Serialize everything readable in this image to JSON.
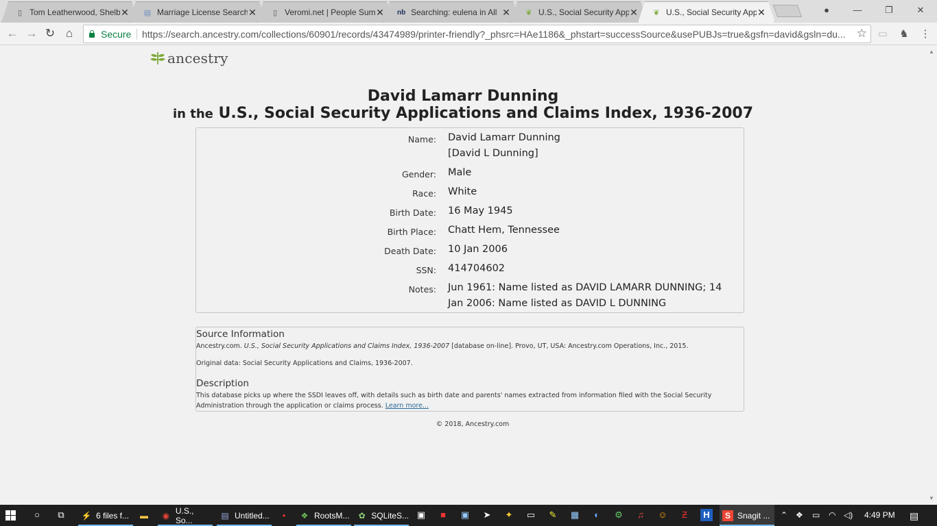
{
  "browser": {
    "tabs": [
      {
        "title": "Tom Leatherwood, Shelby",
        "icon": "document-icon"
      },
      {
        "title": "Marriage License Search",
        "icon": "page-icon"
      },
      {
        "title": "Veromi.net | People Sum",
        "icon": "document-icon"
      },
      {
        "title": "Searching: eulena in All",
        "icon": "nb-icon"
      },
      {
        "title": "U.S., Social Security App",
        "icon": "ancestry-leaf-icon"
      },
      {
        "title": "U.S., Social Security App",
        "icon": "ancestry-leaf-icon",
        "active": true
      }
    ],
    "secure_label": "Secure",
    "url": "https://search.ancestry.com/collections/60901/records/43474989/printer-friendly?_phsrc=HAe1186&_phstart=successSource&usePUBJs=true&gsfn=david&gsln=du..."
  },
  "page": {
    "logo_text": "ancestry",
    "person_name": "David Lamarr Dunning",
    "title_prefix": "in the",
    "collection_title": "U.S., Social Security Applications and Claims Index, 1936-2007",
    "fields": {
      "name": {
        "label": "Name:",
        "value": "David Lamarr Dunning",
        "value2": "[David L Dunning]"
      },
      "gender": {
        "label": "Gender:",
        "value": "Male"
      },
      "race": {
        "label": "Race:",
        "value": "White"
      },
      "birth_date": {
        "label": "Birth Date:",
        "value": "16 May 1945"
      },
      "birth_place": {
        "label": "Birth Place:",
        "value": "Chatt Hem, Tennessee"
      },
      "death_date": {
        "label": "Death Date:",
        "value": "10 Jan 2006"
      },
      "ssn": {
        "label": "SSN:",
        "value": "414704602"
      },
      "notes": {
        "label": "Notes:",
        "value": "Jun 1961: Name listed as DAVID LAMARR DUNNING; 14 Jan 2006: Name listed as DAVID L DUNNING"
      }
    },
    "source": {
      "heading": "Source Information",
      "citation_pre": "Ancestry.com.",
      "citation_title": "U.S., Social Security Applications and Claims Index, 1936-2007",
      "citation_post": "[database on-line]. Provo, UT, USA: Ancestry.com Operations, Inc., 2015.",
      "original_data": "Original data: Social Security Applications and Claims, 1936-2007."
    },
    "description": {
      "heading": "Description",
      "text": "This database picks up where the SSDI leaves off, with details such as birth date and parents' names extracted from information filed with the Social Security Administration through the application or claims process.",
      "link": "Learn more..."
    },
    "copyright": "© 2018, Ancestry.com"
  },
  "taskbar": {
    "apps": [
      {
        "label": "6 files f...",
        "icon": "git-icon"
      },
      {
        "label": "",
        "icon": "folder-icon"
      },
      {
        "label": "U.S., So...",
        "icon": "chrome-icon"
      },
      {
        "label": "Untitled...",
        "icon": "notepad-icon"
      },
      {
        "label": "",
        "icon": "red-dot-icon"
      },
      {
        "label": "RootsM...",
        "icon": "rootsmagic-icon"
      },
      {
        "label": "SQLiteS...",
        "icon": "sqlite-icon"
      },
      {
        "label": "Snagit ...",
        "icon": "snagit-icon"
      }
    ],
    "time": "4:49 PM"
  },
  "colors": {
    "ancestry_green": "#7ea93a",
    "secure_green": "#0b8043",
    "link_blue": "#2c6a9a"
  }
}
